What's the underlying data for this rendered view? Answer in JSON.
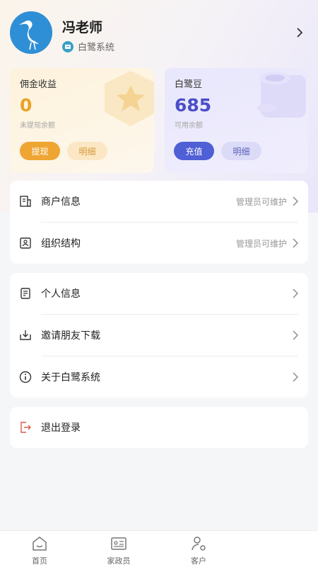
{
  "profile": {
    "name": "冯老师",
    "org": "白鹭系统",
    "avatar_icon": "egret-logo-icon"
  },
  "cards": {
    "commission": {
      "title": "佣金收益",
      "value": "0",
      "sub": "未提现余额",
      "primary_label": "提现",
      "secondary_label": "明细",
      "accent": "#eea532"
    },
    "beans": {
      "title": "白鹭豆",
      "value": "685",
      "sub": "可用余额",
      "primary_label": "充值",
      "secondary_label": "明细",
      "accent": "#4f5fd5"
    }
  },
  "group1": {
    "items": [
      {
        "label": "商户信息",
        "hint": "管理员可维护",
        "icon": "merchant-icon"
      },
      {
        "label": "组织结构",
        "hint": "管理员可维护",
        "icon": "org-structure-icon"
      }
    ]
  },
  "group2": {
    "items": [
      {
        "label": "个人信息",
        "icon": "personal-info-icon"
      },
      {
        "label": "邀请朋友下载",
        "icon": "download-icon"
      },
      {
        "label": "关于白鹭系统",
        "icon": "info-icon"
      }
    ]
  },
  "logout": {
    "label": "退出登录",
    "icon": "logout-icon",
    "color": "#e05a4a"
  },
  "tabbar": {
    "items": [
      {
        "label": "首页",
        "icon": "home-icon"
      },
      {
        "label": "家政员",
        "icon": "id-card-icon"
      },
      {
        "label": "客户",
        "icon": "customer-icon"
      }
    ]
  }
}
